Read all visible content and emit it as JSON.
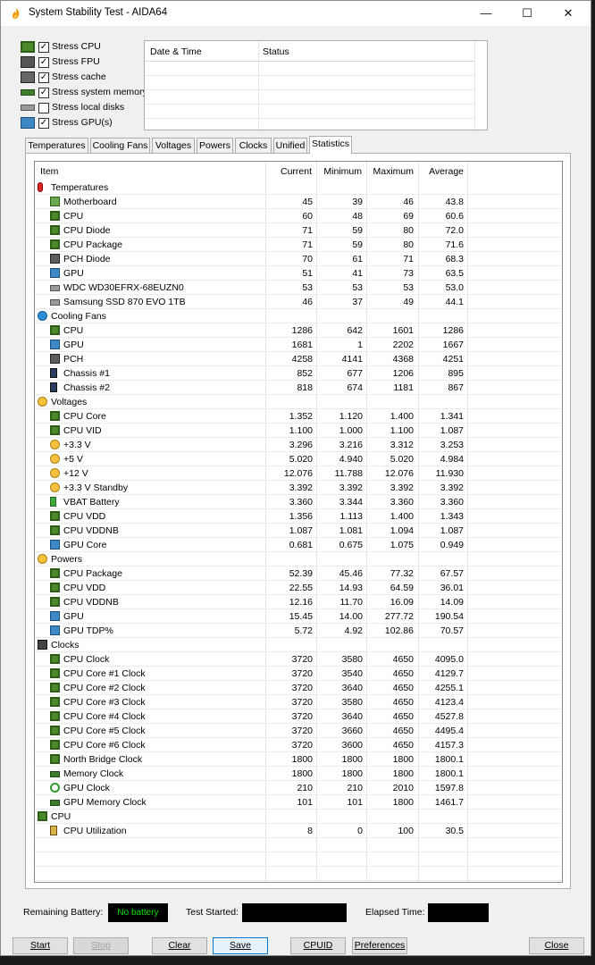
{
  "window": {
    "title": "System Stability Test - AIDA64"
  },
  "stress_options": [
    {
      "label": "Stress CPU",
      "checked": true,
      "icon": "cpu-icon"
    },
    {
      "label": "Stress FPU",
      "checked": true,
      "icon": "fpu-icon"
    },
    {
      "label": "Stress cache",
      "checked": true,
      "icon": "cache-icon"
    },
    {
      "label": "Stress system memory",
      "checked": true,
      "icon": "memory-icon"
    },
    {
      "label": "Stress local disks",
      "checked": false,
      "icon": "disk-icon"
    },
    {
      "label": "Stress GPU(s)",
      "checked": true,
      "icon": "gpu-icon"
    }
  ],
  "datetime_panel": {
    "col1": "Date & Time",
    "col2": "Status"
  },
  "tabs": [
    "Temperatures",
    "Cooling Fans",
    "Voltages",
    "Powers",
    "Clocks",
    "Unified",
    "Statistics"
  ],
  "active_tab": "Statistics",
  "table": {
    "columns": [
      "Item",
      "Current",
      "Minimum",
      "Maximum",
      "Average"
    ],
    "rows": [
      {
        "kind": "group",
        "name": "Temperatures",
        "icon": "thermometer-icon"
      },
      {
        "kind": "item",
        "name": "Motherboard",
        "icon": "motherboard-icon",
        "cur": "45",
        "min": "39",
        "max": "46",
        "avg": "43.8"
      },
      {
        "kind": "item",
        "name": "CPU",
        "icon": "cpu-icon",
        "cur": "60",
        "min": "48",
        "max": "69",
        "avg": "60.6"
      },
      {
        "kind": "item",
        "name": "CPU Diode",
        "icon": "cpu-icon",
        "cur": "71",
        "min": "59",
        "max": "80",
        "avg": "72.0"
      },
      {
        "kind": "item",
        "name": "CPU Package",
        "icon": "cpu-icon",
        "cur": "71",
        "min": "59",
        "max": "80",
        "avg": "71.6"
      },
      {
        "kind": "item",
        "name": "PCH Diode",
        "icon": "chip-icon",
        "cur": "70",
        "min": "61",
        "max": "71",
        "avg": "68.3"
      },
      {
        "kind": "item",
        "name": "GPU",
        "icon": "gpu-icon",
        "cur": "51",
        "min": "41",
        "max": "73",
        "avg": "63.5"
      },
      {
        "kind": "item",
        "name": "WDC WD30EFRX-68EUZN0",
        "icon": "disk-icon",
        "cur": "53",
        "min": "53",
        "max": "53",
        "avg": "53.0"
      },
      {
        "kind": "item",
        "name": "Samsung SSD 870 EVO 1TB",
        "icon": "disk-icon",
        "cur": "46",
        "min": "37",
        "max": "49",
        "avg": "44.1"
      },
      {
        "kind": "group",
        "name": "Cooling Fans",
        "icon": "fan-icon"
      },
      {
        "kind": "item",
        "name": "CPU",
        "icon": "cpu-icon",
        "cur": "1286",
        "min": "642",
        "max": "1601",
        "avg": "1286"
      },
      {
        "kind": "item",
        "name": "GPU",
        "icon": "gpu-icon",
        "cur": "1681",
        "min": "1",
        "max": "2202",
        "avg": "1667"
      },
      {
        "kind": "item",
        "name": "PCH",
        "icon": "chip-icon",
        "cur": "4258",
        "min": "4141",
        "max": "4368",
        "avg": "4251"
      },
      {
        "kind": "item",
        "name": "Chassis #1",
        "icon": "chassis-icon",
        "cur": "852",
        "min": "677",
        "max": "1206",
        "avg": "895"
      },
      {
        "kind": "item",
        "name": "Chassis #2",
        "icon": "chassis-icon",
        "cur": "818",
        "min": "674",
        "max": "1181",
        "avg": "867"
      },
      {
        "kind": "group",
        "name": "Voltages",
        "icon": "voltage-icon"
      },
      {
        "kind": "item",
        "name": "CPU Core",
        "icon": "cpu-icon",
        "cur": "1.352",
        "min": "1.120",
        "max": "1.400",
        "avg": "1.341"
      },
      {
        "kind": "item",
        "name": "CPU VID",
        "icon": "cpu-icon",
        "cur": "1.100",
        "min": "1.000",
        "max": "1.100",
        "avg": "1.087"
      },
      {
        "kind": "item",
        "name": "+3.3 V",
        "icon": "voltage-icon",
        "cur": "3.296",
        "min": "3.216",
        "max": "3.312",
        "avg": "3.253"
      },
      {
        "kind": "item",
        "name": "+5 V",
        "icon": "voltage-icon",
        "cur": "5.020",
        "min": "4.940",
        "max": "5.020",
        "avg": "4.984"
      },
      {
        "kind": "item",
        "name": "+12 V",
        "icon": "voltage-icon",
        "cur": "12.076",
        "min": "11.788",
        "max": "12.076",
        "avg": "11.930"
      },
      {
        "kind": "item",
        "name": "+3.3 V Standby",
        "icon": "voltage-icon",
        "cur": "3.392",
        "min": "3.392",
        "max": "3.392",
        "avg": "3.392"
      },
      {
        "kind": "item",
        "name": "VBAT Battery",
        "icon": "battery-icon",
        "cur": "3.360",
        "min": "3.344",
        "max": "3.360",
        "avg": "3.360"
      },
      {
        "kind": "item",
        "name": "CPU VDD",
        "icon": "cpu-icon",
        "cur": "1.356",
        "min": "1.113",
        "max": "1.400",
        "avg": "1.343"
      },
      {
        "kind": "item",
        "name": "CPU VDDNB",
        "icon": "cpu-icon",
        "cur": "1.087",
        "min": "1.081",
        "max": "1.094",
        "avg": "1.087"
      },
      {
        "kind": "item",
        "name": "GPU Core",
        "icon": "gpu-icon",
        "cur": "0.681",
        "min": "0.675",
        "max": "1.075",
        "avg": "0.949"
      },
      {
        "kind": "group",
        "name": "Powers",
        "icon": "power-icon"
      },
      {
        "kind": "item",
        "name": "CPU Package",
        "icon": "cpu-icon",
        "cur": "52.39",
        "min": "45.46",
        "max": "77.32",
        "avg": "67.57"
      },
      {
        "kind": "item",
        "name": "CPU VDD",
        "icon": "cpu-icon",
        "cur": "22.55",
        "min": "14.93",
        "max": "64.59",
        "avg": "36.01"
      },
      {
        "kind": "item",
        "name": "CPU VDDNB",
        "icon": "cpu-icon",
        "cur": "12.16",
        "min": "11.70",
        "max": "16.09",
        "avg": "14.09"
      },
      {
        "kind": "item",
        "name": "GPU",
        "icon": "gpu-icon",
        "cur": "15.45",
        "min": "14.00",
        "max": "277.72",
        "avg": "190.54"
      },
      {
        "kind": "item",
        "name": "GPU TDP%",
        "icon": "gpu-icon",
        "cur": "5.72",
        "min": "4.92",
        "max": "102.86",
        "avg": "70.57"
      },
      {
        "kind": "group",
        "name": "Clocks",
        "icon": "clock-icon"
      },
      {
        "kind": "item",
        "name": "CPU Clock",
        "icon": "cpu-icon",
        "cur": "3720",
        "min": "3580",
        "max": "4650",
        "avg": "4095.0"
      },
      {
        "kind": "item",
        "name": "CPU Core #1 Clock",
        "icon": "cpu-icon",
        "cur": "3720",
        "min": "3540",
        "max": "4650",
        "avg": "4129.7"
      },
      {
        "kind": "item",
        "name": "CPU Core #2 Clock",
        "icon": "cpu-icon",
        "cur": "3720",
        "min": "3640",
        "max": "4650",
        "avg": "4255.1"
      },
      {
        "kind": "item",
        "name": "CPU Core #3 Clock",
        "icon": "cpu-icon",
        "cur": "3720",
        "min": "3580",
        "max": "4650",
        "avg": "4123.4"
      },
      {
        "kind": "item",
        "name": "CPU Core #4 Clock",
        "icon": "cpu-icon",
        "cur": "3720",
        "min": "3640",
        "max": "4650",
        "avg": "4527.8"
      },
      {
        "kind": "item",
        "name": "CPU Core #5 Clock",
        "icon": "cpu-icon",
        "cur": "3720",
        "min": "3660",
        "max": "4650",
        "avg": "4495.4"
      },
      {
        "kind": "item",
        "name": "CPU Core #6 Clock",
        "icon": "cpu-icon",
        "cur": "3720",
        "min": "3600",
        "max": "4650",
        "avg": "4157.3"
      },
      {
        "kind": "item",
        "name": "North Bridge Clock",
        "icon": "cpu-icon",
        "cur": "1800",
        "min": "1800",
        "max": "1800",
        "avg": "1800.1"
      },
      {
        "kind": "item",
        "name": "Memory Clock",
        "icon": "memory-icon",
        "cur": "1800",
        "min": "1800",
        "max": "1800",
        "avg": "1800.1"
      },
      {
        "kind": "item",
        "name": "GPU Clock",
        "icon": "xbox-icon",
        "cur": "210",
        "min": "210",
        "max": "2010",
        "avg": "1597.8"
      },
      {
        "kind": "item",
        "name": "GPU Memory Clock",
        "icon": "memory-icon",
        "cur": "101",
        "min": "101",
        "max": "1800",
        "avg": "1461.7"
      },
      {
        "kind": "group",
        "name": "CPU",
        "icon": "cpu-icon"
      },
      {
        "kind": "item",
        "name": "CPU Utilization",
        "icon": "hourglass-icon",
        "cur": "8",
        "min": "0",
        "max": "100",
        "avg": "30.5"
      }
    ]
  },
  "status": {
    "remaining_battery_label": "Remaining Battery:",
    "remaining_battery_value": "No battery",
    "test_started_label": "Test Started:",
    "test_started_value": "",
    "elapsed_label": "Elapsed Time:",
    "elapsed_value": ""
  },
  "buttons": {
    "start": "Start",
    "stop": "Stop",
    "clear": "Clear",
    "save": "Save",
    "cpuid": "CPUID",
    "preferences": "Preferences",
    "close": "Close"
  },
  "colors": {
    "accent": "#0078d7",
    "battery_text": "#00e000"
  }
}
